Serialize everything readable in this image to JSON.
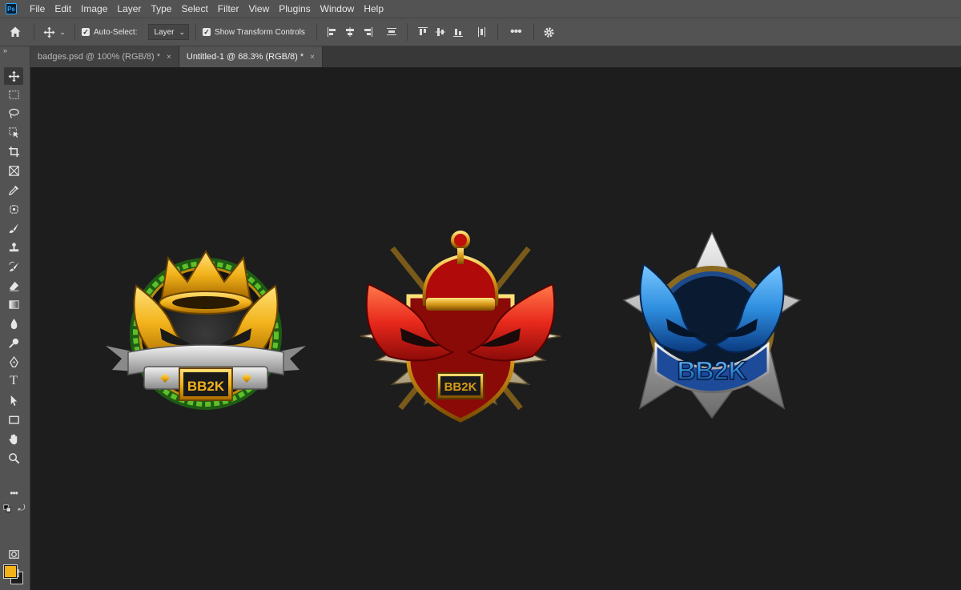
{
  "app": {
    "logo_text": "Ps"
  },
  "menu": [
    "File",
    "Edit",
    "Image",
    "Layer",
    "Type",
    "Select",
    "Filter",
    "View",
    "Plugins",
    "Window",
    "Help"
  ],
  "options": {
    "auto_select_label": "Auto-Select:",
    "auto_select_checked": true,
    "auto_select_target": "Layer",
    "show_transform_label": "Show Transform Controls",
    "show_transform_checked": true,
    "more_icon": "ellipsis-icon",
    "settings_icon": "gear-icon"
  },
  "tabs": [
    {
      "title": "badges.psd @ 100% (RGB/8) *",
      "close": "×",
      "active": false
    },
    {
      "title": "Untitled-1 @ 68.3% (RGB/8) *",
      "close": "×",
      "active": true
    }
  ],
  "tools": [
    "move-tool",
    "marquee-tool",
    "lasso-tool",
    "object-selection-tool",
    "crop-tool",
    "frame-tool",
    "eyedropper-tool",
    "spot-healing-tool",
    "brush-tool",
    "clone-stamp-tool",
    "history-brush-tool",
    "eraser-tool",
    "gradient-tool",
    "blur-tool",
    "dodge-tool",
    "pen-tool",
    "type-tool",
    "path-selection-tool",
    "rectangle-tool",
    "hand-tool",
    "zoom-tool",
    "more-tools"
  ],
  "colors": {
    "foreground": "#f2b21a",
    "background": "#1c1c1c"
  },
  "badges": [
    {
      "text": "BB2K",
      "theme": "gold",
      "accent": "#f2b21a"
    },
    {
      "text": "BB2K",
      "theme": "red",
      "accent": "#e8291c"
    },
    {
      "text": "BB2K",
      "theme": "blue",
      "accent": "#2f8fe0"
    }
  ]
}
